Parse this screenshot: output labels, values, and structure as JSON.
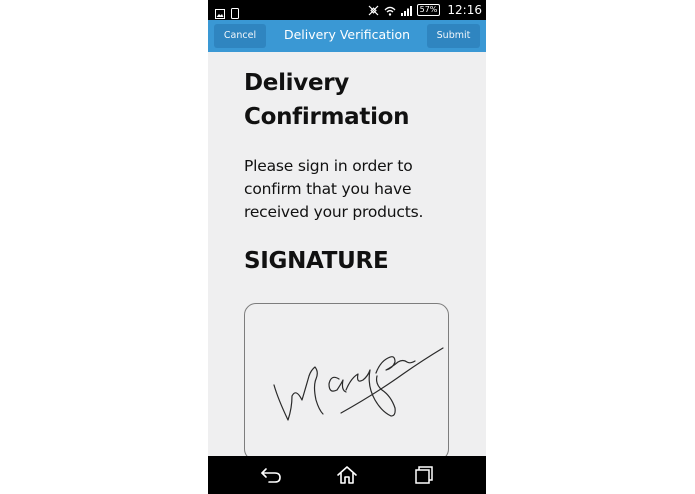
{
  "status_bar": {
    "left_icons": [
      "image-notification-icon",
      "device-notification-icon"
    ],
    "right_icons": [
      "nfc-icon",
      "wifi-icon",
      "cell-signal-icon",
      "battery-icon"
    ],
    "battery": "57%",
    "time": "12:16"
  },
  "header": {
    "title": "Delivery Verification",
    "cancel_label": "Cancel",
    "submit_label": "Submit"
  },
  "main": {
    "heading": "Delivery Confirmation",
    "instructions": "Please sign in order to confirm that you have received your products.",
    "signature_heading": "SIGNATURE"
  },
  "nav": {
    "buttons": [
      "back-icon",
      "home-icon",
      "recent-apps-icon"
    ]
  },
  "colors": {
    "header_bg": "#3a98d4",
    "button_bg": "#2f85c0",
    "page_bg": "#efeff0",
    "bars": "#000000"
  }
}
